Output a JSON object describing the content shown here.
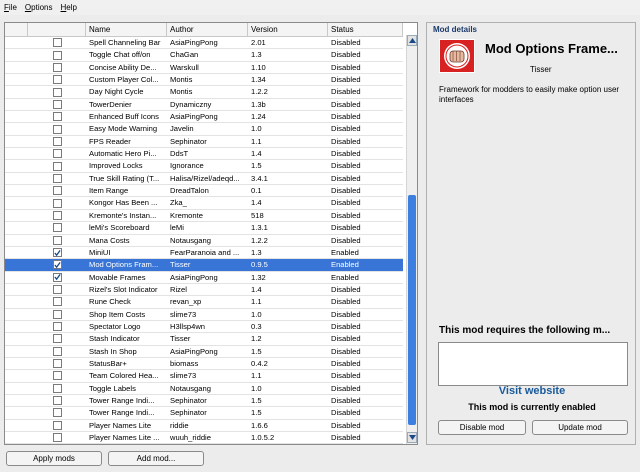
{
  "menubar": {
    "items": [
      "File",
      "Options",
      "Help"
    ]
  },
  "table": {
    "columns": [
      "",
      "",
      "Name",
      "Author",
      "Version",
      "Status"
    ],
    "rows": [
      {
        "checked": false,
        "name": "Spell Channeling Bar",
        "author": "AsiaPingPong",
        "version": "2.01",
        "status": "Disabled",
        "selected": false
      },
      {
        "checked": false,
        "name": "Toggle Chat off/on",
        "author": "ChaGan",
        "version": "1.3",
        "status": "Disabled",
        "selected": false
      },
      {
        "checked": false,
        "name": "Concise Ability De...",
        "author": "Warskull",
        "version": "1.10",
        "status": "Disabled",
        "selected": false
      },
      {
        "checked": false,
        "name": "Custom Player Col...",
        "author": "Montis",
        "version": "1.34",
        "status": "Disabled",
        "selected": false
      },
      {
        "checked": false,
        "name": "Day Night Cycle",
        "author": "Montis",
        "version": "1.2.2",
        "status": "Disabled",
        "selected": false
      },
      {
        "checked": false,
        "name": "TowerDenier",
        "author": "Dynamiczny",
        "version": "1.3b",
        "status": "Disabled",
        "selected": false
      },
      {
        "checked": false,
        "name": "Enhanced Buff Icons",
        "author": "AsiaPingPong",
        "version": "1.24",
        "status": "Disabled",
        "selected": false
      },
      {
        "checked": false,
        "name": "Easy Mode Warning",
        "author": "Javelin",
        "version": "1.0",
        "status": "Disabled",
        "selected": false
      },
      {
        "checked": false,
        "name": "FPS Reader",
        "author": "Sephinator",
        "version": "1.1",
        "status": "Disabled",
        "selected": false
      },
      {
        "checked": false,
        "name": "Automatic Hero Pi...",
        "author": "DdsT",
        "version": "1.4",
        "status": "Disabled",
        "selected": false
      },
      {
        "checked": false,
        "name": "Improved Locks",
        "author": "Ignorance",
        "version": "1.5",
        "status": "Disabled",
        "selected": false
      },
      {
        "checked": false,
        "name": "True Skill Rating (T...",
        "author": "Halisa/Rizel/adeqd...",
        "version": "3.4.1",
        "status": "Disabled",
        "selected": false
      },
      {
        "checked": false,
        "name": "Item Range",
        "author": "DreadTalon",
        "version": "0.1",
        "status": "Disabled",
        "selected": false
      },
      {
        "checked": false,
        "name": "Kongor Has Been ...",
        "author": "Zka_",
        "version": "1.4",
        "status": "Disabled",
        "selected": false
      },
      {
        "checked": false,
        "name": "Kremonte's Instan...",
        "author": "Kremonte",
        "version": "518",
        "status": "Disabled",
        "selected": false
      },
      {
        "checked": false,
        "name": "leMi's Scoreboard",
        "author": "leMi",
        "version": "1.3.1",
        "status": "Disabled",
        "selected": false
      },
      {
        "checked": false,
        "name": "Mana Costs",
        "author": "Notausgang",
        "version": "1.2.2",
        "status": "Disabled",
        "selected": false
      },
      {
        "checked": true,
        "name": "MiniUI",
        "author": "FearParanoia and ...",
        "version": "1.3",
        "status": "Enabled",
        "selected": false
      },
      {
        "checked": true,
        "name": "Mod Options Fram...",
        "author": "Tisser",
        "version": "0.9.5",
        "status": "Enabled",
        "selected": true
      },
      {
        "checked": true,
        "name": "Movable Frames",
        "author": "AsiaPingPong",
        "version": "1.32",
        "status": "Enabled",
        "selected": false
      },
      {
        "checked": false,
        "name": "Rizel's Slot Indicator",
        "author": "Rizel",
        "version": "1.4",
        "status": "Disabled",
        "selected": false
      },
      {
        "checked": false,
        "name": "Rune Check",
        "author": "revan_xp",
        "version": "1.1",
        "status": "Disabled",
        "selected": false
      },
      {
        "checked": false,
        "name": "Shop Item Costs",
        "author": "slime73",
        "version": "1.0",
        "status": "Disabled",
        "selected": false
      },
      {
        "checked": false,
        "name": "Spectator Logo",
        "author": "H3llsp4wn",
        "version": "0.3",
        "status": "Disabled",
        "selected": false
      },
      {
        "checked": false,
        "name": "Stash Indicator",
        "author": "Tisser",
        "version": "1.2",
        "status": "Disabled",
        "selected": false
      },
      {
        "checked": false,
        "name": "Stash In Shop",
        "author": "AsiaPingPong",
        "version": "1.5",
        "status": "Disabled",
        "selected": false
      },
      {
        "checked": false,
        "name": "StatusBar+",
        "author": "biomass",
        "version": "0.4.2",
        "status": "Disabled",
        "selected": false
      },
      {
        "checked": false,
        "name": "Team Colored Hea...",
        "author": "slime73",
        "version": "1.1",
        "status": "Disabled",
        "selected": false
      },
      {
        "checked": false,
        "name": "Toggle Labels",
        "author": "Notausgang",
        "version": "1.0",
        "status": "Disabled",
        "selected": false
      },
      {
        "checked": false,
        "name": "Tower Range Indi...",
        "author": "Sephinator",
        "version": "1.5",
        "status": "Disabled",
        "selected": false
      },
      {
        "checked": false,
        "name": "Tower Range Indi...",
        "author": "Sephinator",
        "version": "1.5",
        "status": "Disabled",
        "selected": false
      },
      {
        "checked": false,
        "name": "Player Names Lite",
        "author": "riddie",
        "version": "1.6.6",
        "status": "Disabled",
        "selected": false
      },
      {
        "checked": false,
        "name": "Player Names Lite ...",
        "author": "wuuh_riddie",
        "version": "1.0.5.2",
        "status": "Disabled",
        "selected": false
      }
    ]
  },
  "buttons": {
    "apply": "Apply mods",
    "add": "Add mod..."
  },
  "details": {
    "title": "Mod details",
    "mod_name": "Mod Options Frame...",
    "author": "Tisser",
    "description": "Framework for modders to easily make option user interfaces",
    "requires_label": "This mod requires the following m...",
    "requires_value": "",
    "visit_label": "Visit website",
    "status_message": "This mod is currently enabled",
    "disable_button": "Disable mod",
    "update_button": "Update mod"
  },
  "colors": {
    "selection": "#3875d7",
    "link": "#1a5a9b",
    "logo_red": "#d82222",
    "scroll_thumb": "#3c7fe0"
  }
}
